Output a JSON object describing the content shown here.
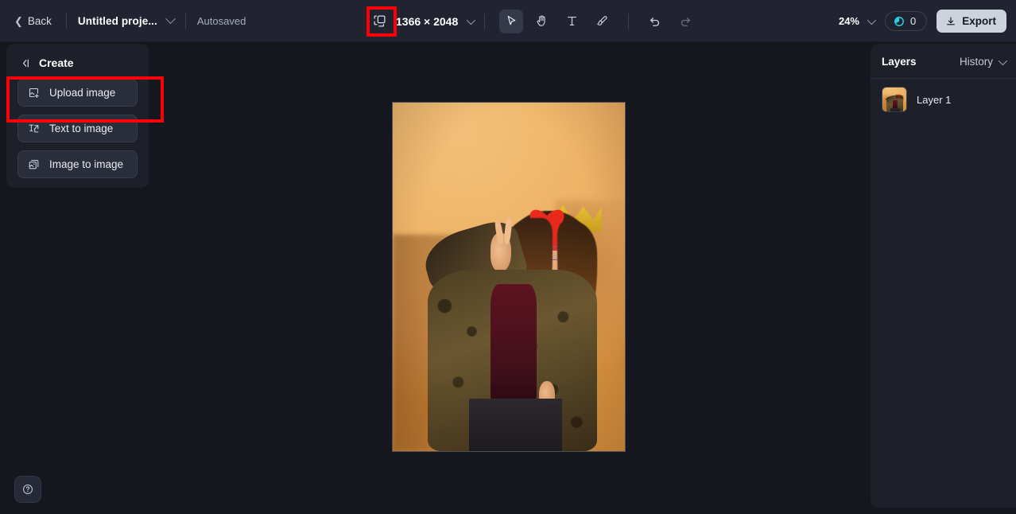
{
  "topbar": {
    "back_label": "Back",
    "project_name": "Untitled proje...",
    "autosave_status": "Autosaved",
    "canvas_dimensions": "1366 × 2048",
    "zoom_level": "24%",
    "credits_count": "0",
    "export_label": "Export",
    "tools": [
      {
        "name": "select-tool",
        "active": true
      },
      {
        "name": "hand-tool",
        "active": false
      },
      {
        "name": "text-tool",
        "active": false
      },
      {
        "name": "brush-tool",
        "active": false
      },
      {
        "name": "undo-tool",
        "active": false
      },
      {
        "name": "redo-tool",
        "active": false
      }
    ]
  },
  "create_panel": {
    "title": "Create",
    "items": [
      {
        "label": "Upload image",
        "icon": "image-plus-icon",
        "highlighted": true
      },
      {
        "label": "Text to image",
        "icon": "text-to-image-icon",
        "highlighted": false
      },
      {
        "label": "Image to image",
        "icon": "image-to-image-icon",
        "highlighted": false
      }
    ]
  },
  "layers_panel": {
    "title": "Layers",
    "history_label": "History",
    "layers": [
      {
        "name": "Layer 1"
      }
    ]
  },
  "help": {
    "label": "?"
  },
  "colors": {
    "app_background": "#16171e",
    "topbar_background": "#212430",
    "panel_background": "#1d2029",
    "button_background": "#2a2e3b",
    "accent_highlight": "#fb0007",
    "credits_accent": "#2ad2e8",
    "export_background": "#ccd3dd",
    "text_primary": "#ffffff",
    "text_secondary": "#a6adbb"
  }
}
